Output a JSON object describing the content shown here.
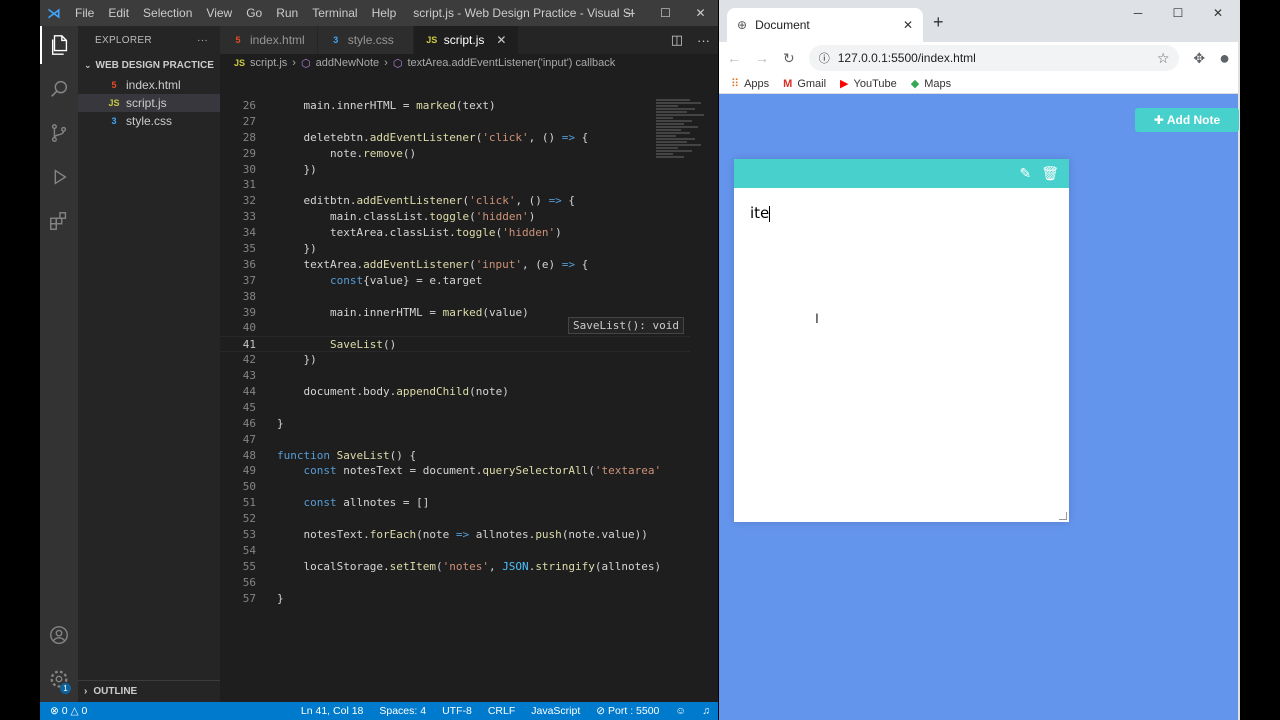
{
  "vscode": {
    "menu": [
      "File",
      "Edit",
      "Selection",
      "View",
      "Go",
      "Run",
      "Terminal",
      "Help"
    ],
    "window_title": "script.js - Web Design Practice - Visual Studio C...",
    "explorer": {
      "header": "EXPLORER",
      "more": "···",
      "folder": "WEB DESIGN PRACTICE",
      "files": [
        {
          "name": "index.html",
          "icon": "5",
          "color": "#e44d26"
        },
        {
          "name": "script.js",
          "icon": "JS",
          "color": "#cbcb41"
        },
        {
          "name": "style.css",
          "icon": "3",
          "color": "#42a5f5"
        }
      ],
      "outline": "OUTLINE"
    },
    "tabs": [
      {
        "label": "index.html",
        "icon": "5",
        "color": "#e44d26"
      },
      {
        "label": "style.css",
        "icon": "3",
        "color": "#42a5f5"
      },
      {
        "label": "script.js",
        "icon": "JS",
        "color": "#cbcb41"
      }
    ],
    "breadcrumb": [
      "script.js",
      "addNewNote",
      "textArea.addEventListener('input') callback"
    ],
    "code": [
      {
        "n": "26",
        "t": "    main.innerHTML = marked(text)"
      },
      {
        "n": "27",
        "t": ""
      },
      {
        "n": "28",
        "t": "    deletebtn.addEventListener('click', () => {"
      },
      {
        "n": "29",
        "t": "        note.remove()"
      },
      {
        "n": "30",
        "t": "    })"
      },
      {
        "n": "31",
        "t": ""
      },
      {
        "n": "32",
        "t": "    editbtn.addEventListener('click', () => {"
      },
      {
        "n": "33",
        "t": "        main.classList.toggle('hidden')"
      },
      {
        "n": "34",
        "t": "        textArea.classList.toggle('hidden')"
      },
      {
        "n": "35",
        "t": "    })"
      },
      {
        "n": "36",
        "t": "    textArea.addEventListener('input', (e) => {"
      },
      {
        "n": "37",
        "t": "        const{value} = e.target"
      },
      {
        "n": "38",
        "t": ""
      },
      {
        "n": "39",
        "t": "        main.innerHTML = marked(value)"
      },
      {
        "n": "40",
        "t": ""
      },
      {
        "n": "41",
        "t": "        SaveList()"
      },
      {
        "n": "42",
        "t": "    })"
      },
      {
        "n": "43",
        "t": ""
      },
      {
        "n": "44",
        "t": "    document.body.appendChild(note)"
      },
      {
        "n": "45",
        "t": ""
      },
      {
        "n": "46",
        "t": "}"
      },
      {
        "n": "47",
        "t": ""
      },
      {
        "n": "48",
        "t": "function SaveList() {"
      },
      {
        "n": "49",
        "t": "    const notesText = document.querySelectorAll('textarea'"
      },
      {
        "n": "50",
        "t": ""
      },
      {
        "n": "51",
        "t": "    const allnotes = []"
      },
      {
        "n": "52",
        "t": ""
      },
      {
        "n": "53",
        "t": "    notesText.forEach(note => allnotes.push(note.value))"
      },
      {
        "n": "54",
        "t": ""
      },
      {
        "n": "55",
        "t": "    localStorage.setItem('notes', JSON.stringify(allnotes)"
      },
      {
        "n": "56",
        "t": ""
      },
      {
        "n": "57",
        "t": "}"
      }
    ],
    "tooltip": "SaveList(): void",
    "status": {
      "errors": "0",
      "warnings": "0",
      "position": "Ln 41, Col 18",
      "spaces": "Spaces: 4",
      "encoding": "UTF-8",
      "eol": "CRLF",
      "language": "JavaScript",
      "port": "Port : 5500"
    }
  },
  "chrome": {
    "tab_title": "Document",
    "url": "127.0.0.1:5500/index.html",
    "bookmarks": [
      "Apps",
      "Gmail",
      "YouTube",
      "Maps"
    ],
    "add_note": "Add Note",
    "note_text": "ite"
  },
  "colors": {
    "page_bg": "#6495ed",
    "accent": "#48d1cc",
    "vscode_status": "#007acc"
  }
}
